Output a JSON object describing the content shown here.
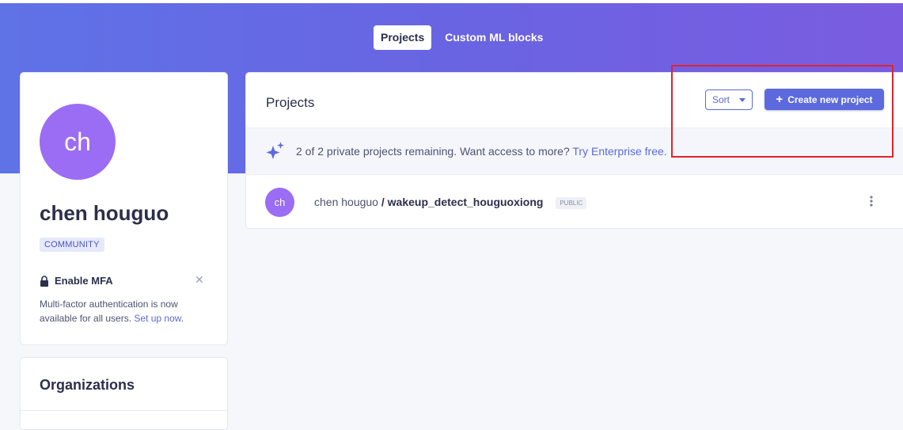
{
  "nav": {
    "tabs": [
      {
        "label": "Projects",
        "active": true
      },
      {
        "label": "Custom ML blocks",
        "active": false
      }
    ]
  },
  "profile": {
    "avatar_initials": "ch",
    "name": "chen houguo",
    "tier_badge": "COMMUNITY",
    "mfa": {
      "title": "Enable MFA",
      "text": "Multi-factor authentication is now available for all users.",
      "link": "Set up now",
      "link_suffix": ".",
      "close_icon": "close-icon"
    }
  },
  "organizations": {
    "title": "Organizations"
  },
  "projects": {
    "title": "Projects",
    "sort_label": "Sort",
    "create_label": "Create new project",
    "notice": {
      "text": "2 of 2 private projects remaining. Want access to more?",
      "link": "Try Enterprise free."
    },
    "items": [
      {
        "avatar_initials": "ch",
        "owner": "chen houguo",
        "separator": "/",
        "name": "wakeup_detect_houguoxiong",
        "visibility": "PUBLIC"
      }
    ]
  },
  "colors": {
    "accent": "#5c6ade",
    "avatar": "#9b6cf4",
    "highlight_box": "#e0242c"
  }
}
